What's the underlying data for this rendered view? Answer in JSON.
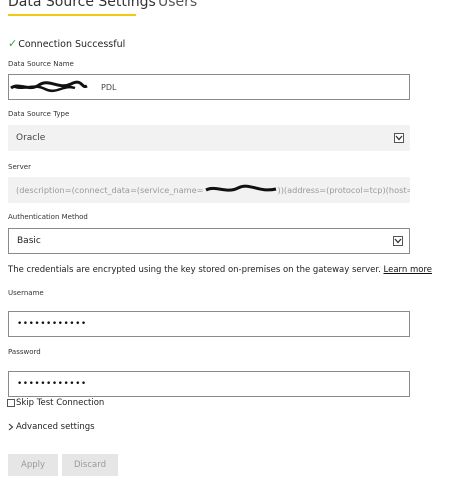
{
  "tabs": [
    {
      "label": "Data Source Settings",
      "active": true
    },
    {
      "label": "Users",
      "active": false
    }
  ],
  "status": {
    "icon": "check-icon",
    "text": "Connection Successful"
  },
  "fields": {
    "data_source_name": {
      "label": "Data Source Name",
      "visible_value": "PDL"
    },
    "data_source_type": {
      "label": "Data Source Type",
      "value": "Oracle"
    },
    "server": {
      "label": "Server",
      "value_prefix": "(description=(connect_data=(service_name=",
      "value_suffix": "))(address=(protocol=tcp)(host="
    },
    "authentication_method": {
      "label": "Authentication Method",
      "value": "Basic"
    }
  },
  "info": {
    "text": "The credentials are encrypted using the key stored on-premises on the gateway server.",
    "link": "Learn more"
  },
  "username": {
    "label": "Username",
    "value": "••••••••••••"
  },
  "password": {
    "label": "Password",
    "value": "••••••••••••"
  },
  "skip_test": {
    "label": "Skip Test Connection",
    "checked": false
  },
  "advanced": {
    "label": "Advanced settings",
    "icon": "chevron-right-icon"
  },
  "buttons": {
    "apply": "Apply",
    "discard": "Discard"
  },
  "colors": {
    "accent": "#f2c811",
    "success": "#3c9d3c",
    "disabled_bg": "#f2f2f2",
    "button_bg": "#e6e6e6"
  }
}
